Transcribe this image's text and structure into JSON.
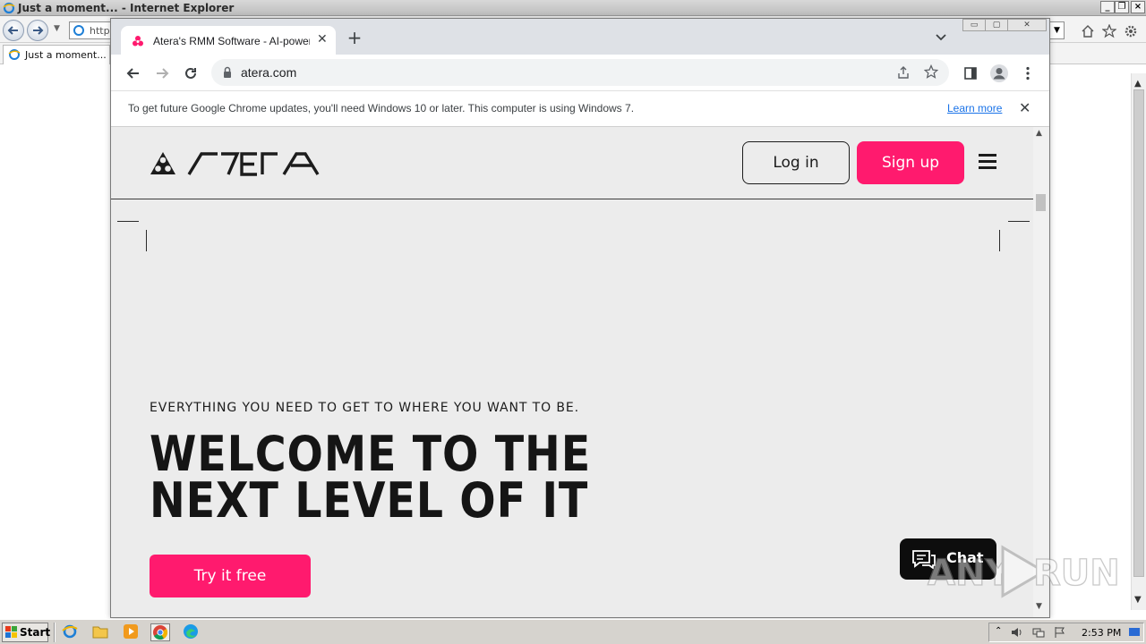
{
  "ie": {
    "title": "Just a moment... - Internet Explorer",
    "address_text": "http:",
    "tab_label": "Just a moment..."
  },
  "chrome": {
    "tab_title": "Atera's RMM Software - AI-powered",
    "url": "atera.com",
    "infobar_message": "To get future Google Chrome updates, you'll need Windows 10 or later. This computer is using Windows 7.",
    "infobar_link": "Learn more"
  },
  "site": {
    "brand": "ATERA",
    "login_label": "Log in",
    "signup_label": "Sign up",
    "hero_kicker": "EVERYTHING YOU NEED TO GET TO WHERE YOU WANT TO BE.",
    "hero_title_line1": "WELCOME TO THE",
    "hero_title_line2": "NEXT LEVEL OF IT",
    "cta_label": "Try it free",
    "chat_label": "Chat",
    "accent_color": "#ff1a6e"
  },
  "watermark": {
    "left": "ANY",
    "right": "RUN"
  },
  "taskbar": {
    "start_label": "Start",
    "clock": "2:53 PM",
    "icons": [
      "ie-icon",
      "explorer-icon",
      "media-player-icon",
      "chrome-icon",
      "edge-icon"
    ]
  }
}
